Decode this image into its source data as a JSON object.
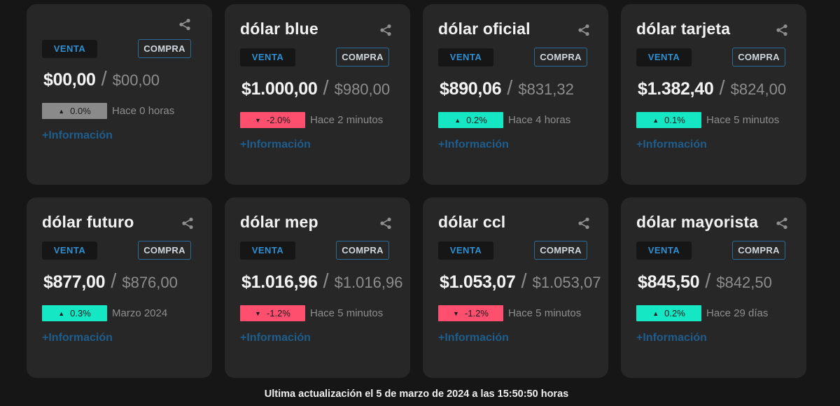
{
  "cards": [
    {
      "title": "",
      "venta": "VENTA",
      "compra": "COMPRA",
      "price_sell": "$00,00",
      "slash": "/",
      "price_buy": "$00,00",
      "arrow": "▲",
      "change": "0.0%",
      "time": "Hace 0 horas",
      "info": "+Información"
    },
    {
      "title": "dólar blue",
      "venta": "VENTA",
      "compra": "COMPRA",
      "price_sell": "$1.000,00",
      "slash": "/",
      "price_buy": "$980,00",
      "arrow": "▼",
      "change": "-2.0%",
      "time": "Hace 2 minutos",
      "info": "+Información"
    },
    {
      "title": "dólar oficial",
      "venta": "VENTA",
      "compra": "COMPRA",
      "price_sell": "$890,06",
      "slash": "/",
      "price_buy": "$831,32",
      "arrow": "▲",
      "change": "0.2%",
      "time": "Hace 4 horas",
      "info": "+Información"
    },
    {
      "title": "dólar tarjeta",
      "venta": "VENTA",
      "compra": "COMPRA",
      "price_sell": "$1.382,40",
      "slash": "/",
      "price_buy": "$824,00",
      "arrow": "▲",
      "change": "0.1%",
      "time": "Hace 5 minutos",
      "info": "+Información"
    },
    {
      "title": "dólar futuro",
      "venta": "VENTA",
      "compra": "COMPRA",
      "price_sell": "$877,00",
      "slash": "/",
      "price_buy": "$876,00",
      "arrow": "▲",
      "change": "0.3%",
      "time": "Marzo 2024",
      "info": "+Información"
    },
    {
      "title": "dólar mep",
      "venta": "VENTA",
      "compra": "COMPRA",
      "price_sell": "$1.016,96",
      "slash": "/",
      "price_buy": "$1.016,96",
      "arrow": "▼",
      "change": "-1.2%",
      "time": "Hace 5 minutos",
      "info": "+Información"
    },
    {
      "title": "dólar ccl",
      "venta": "VENTA",
      "compra": "COMPRA",
      "price_sell": "$1.053,07",
      "slash": "/",
      "price_buy": "$1.053,07",
      "arrow": "▼",
      "change": "-1.2%",
      "time": "Hace 5 minutos",
      "info": "+Información"
    },
    {
      "title": "dólar mayorista",
      "venta": "VENTA",
      "compra": "COMPRA",
      "price_sell": "$845,50",
      "slash": "/",
      "price_buy": "$842,50",
      "arrow": "▲",
      "change": "0.2%",
      "time": "Hace 29 días",
      "info": "+Información"
    }
  ],
  "footer": "Ultima actualización el 5 de marzo de 2024 a las 15:50:50 horas",
  "colors": {
    "up": "#15e6c4",
    "down": "#ff4f6e",
    "neutral": "#8a8a8a",
    "accent": "#2f8fd0"
  },
  "icons": {
    "share": "share-icon",
    "up": "triangle-up-icon",
    "down": "triangle-down-icon"
  }
}
